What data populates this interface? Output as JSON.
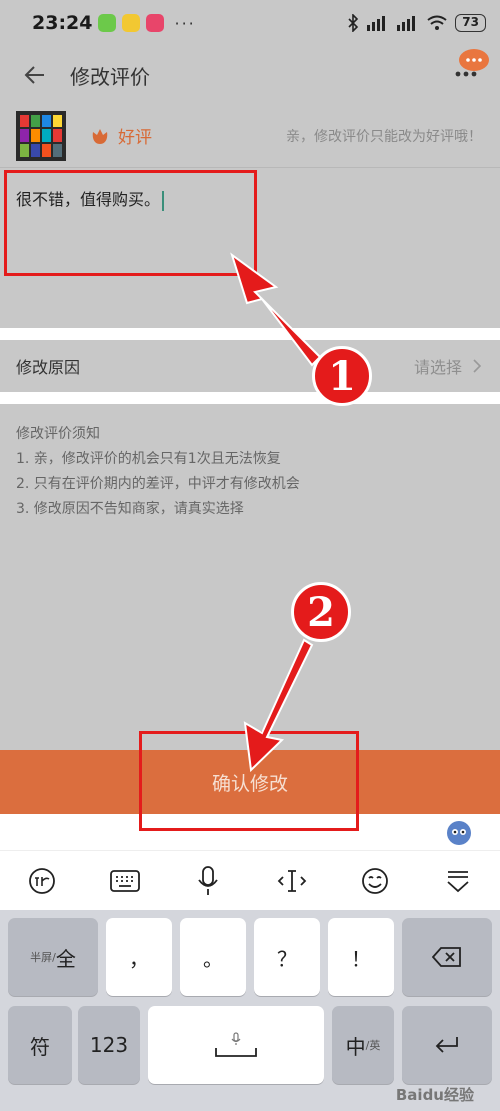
{
  "status_bar": {
    "time": "23:24",
    "battery": "73"
  },
  "header": {
    "title": "修改评价"
  },
  "product": {
    "rating_label": "好评",
    "rating_hint": "亲，修改评价只能改为好评哦！"
  },
  "review": {
    "text": "很不错，值得购买。"
  },
  "reason": {
    "label": "修改原因",
    "value": "请选择"
  },
  "notice": {
    "title": "修改评价须知",
    "lines": [
      "1. 亲，修改评价的机会只有1次且无法恢复",
      "2. 只有在评价期内的差评，中评才有修改机会",
      "3. 修改原因不告知商家，请真实选择"
    ]
  },
  "confirm": {
    "label": "确认修改"
  },
  "keyboard": {
    "row1": [
      "全",
      "，",
      "。",
      "？",
      "！"
    ],
    "half_full_prefix": "半屏/",
    "row2": {
      "symbol": "符",
      "numeric": "123",
      "lang": "中",
      "lang_sub": "/英"
    }
  },
  "annotations": [
    "1",
    "2"
  ],
  "watermark": "Baidu经验",
  "colors": {
    "accent": "#db6e3e",
    "annotation": "#e41b1b",
    "overlay": "#c8c8c8"
  }
}
